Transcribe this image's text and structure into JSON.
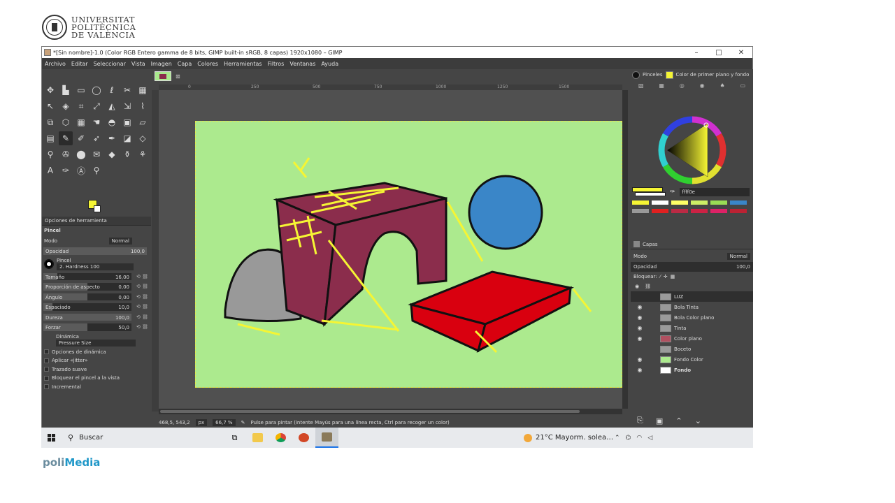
{
  "branding": {
    "university_line1": "UNIVERSITAT",
    "university_line2": "POLITÈCNICA",
    "university_line3": "DE VALÈNCIA",
    "polimedia_a": "poli",
    "polimedia_b": "Media"
  },
  "window": {
    "title": "*[Sin nombre]-1.0 (Color RGB Entero gamma de 8 bits, GIMP built-in sRGB, 8 capas) 1920x1080 – GIMP",
    "minimize": "–",
    "maximize": "□",
    "close": "✕"
  },
  "menu": [
    "Archivo",
    "Editar",
    "Seleccionar",
    "Vista",
    "Imagen",
    "Capa",
    "Colores",
    "Herramientas",
    "Filtros",
    "Ventanas",
    "Ayuda"
  ],
  "tool_options": {
    "tab_label": "Opciones de herramienta",
    "tool_name": "Pincel",
    "mode_label": "Modo",
    "mode_value": "Normal",
    "opacity_label": "Opacidad",
    "opacity_value": "100,0",
    "brush_label": "Pincel",
    "brush_value": "2. Hardness 100",
    "sliders": [
      {
        "label": "Tamaño",
        "value": "16,00",
        "fill": 0.16
      },
      {
        "label": "Proporción de aspecto",
        "value": "0,00",
        "fill": 0.5
      },
      {
        "label": "Ángulo",
        "value": "0,00",
        "fill": 0.5
      },
      {
        "label": "Espaciado",
        "value": "10,0",
        "fill": 0.1
      },
      {
        "label": "Dureza",
        "value": "100,0",
        "fill": 1.0
      },
      {
        "label": "Forzar",
        "value": "50,0",
        "fill": 0.5
      }
    ],
    "dynamics_label": "Dinámica",
    "dynamics_value": "Pressure Size",
    "checks": [
      "Opciones de dinámica",
      "Aplicar «jitter»",
      "Trazado suave",
      "Bloquear el pincel a la vista",
      "Incremental"
    ]
  },
  "ruler": {
    "ticks": [
      "0",
      "250",
      "500",
      "750",
      "1000",
      "1250",
      "1500"
    ]
  },
  "status": {
    "coords": "468,5, 543,2",
    "unit": "px",
    "zoom": "66,7 %",
    "message": "Pulse para pintar (intente Mayús para una línea recta, Ctrl para recoger un color)"
  },
  "dock": {
    "tab_brushes": "Pinceles",
    "tab_fgbg": "Color de primer plano y fondo",
    "hex_value": "ffff0e",
    "layers_tab": "Capas",
    "layers_mode_label": "Modo",
    "layers_mode_value": "Normal",
    "layers_opacity_label": "Opacidad",
    "layers_opacity_value": "100,0",
    "lock_label": "Bloquear:",
    "layers": [
      {
        "name": "LUZ",
        "visible": false,
        "thumb": "#9a9a9a"
      },
      {
        "name": "Bola Tinta",
        "visible": true,
        "thumb": "#9a9a9a"
      },
      {
        "name": "Bola Color plano",
        "visible": true,
        "thumb": "#9a9a9a"
      },
      {
        "name": "Tinta",
        "visible": true,
        "thumb": "#9a9a9a"
      },
      {
        "name": "Color plano",
        "visible": true,
        "thumb": "#b05060"
      },
      {
        "name": "Boceto",
        "visible": false,
        "thumb": "#9a9a9a"
      },
      {
        "name": "Fondo Color",
        "visible": true,
        "thumb": "#acea8e"
      },
      {
        "name": "Fondo",
        "visible": true,
        "thumb": "#ffffff"
      }
    ],
    "palette": [
      "#f5f534",
      "#ffffff",
      "#ffff66",
      "#ccee66",
      "#99dd55",
      "#3a86c8",
      "#999999",
      "#e02020",
      "#bb2a44",
      "#cc2244",
      "#dd2266",
      "#bb2233"
    ]
  },
  "taskbar": {
    "search_label": "Buscar",
    "weather": "21°C  Mayorm. solea…"
  },
  "colors": {
    "canvas_bg": "#acea8e",
    "box_red": "#d9000f",
    "arch_maroon": "#8b2d4c",
    "ball_blue": "#3a86c8",
    "rock_gray": "#999999",
    "sketch_yellow": "#f5f534"
  }
}
